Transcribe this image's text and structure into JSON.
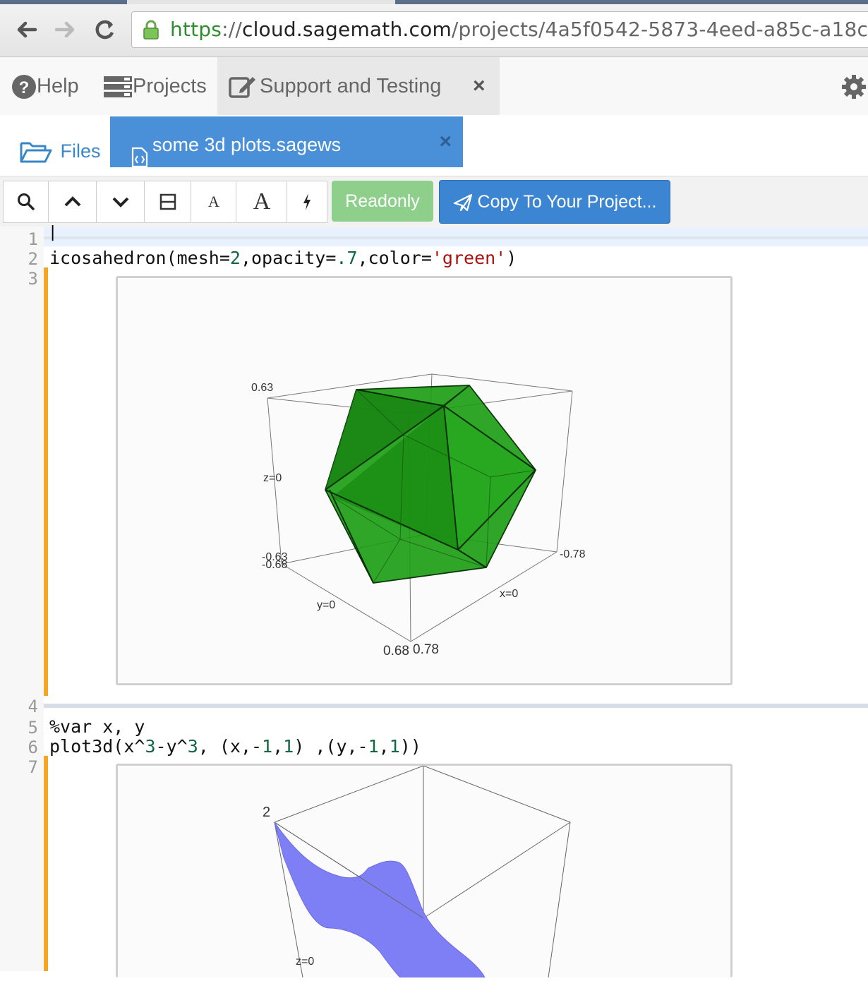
{
  "browser": {
    "url_scheme": "https",
    "url_sep": "://",
    "url_host": "cloud.sagemath.com",
    "url_path": "/projects/4a5f0542-5873-4eed-a85c-a18c",
    "icons": [
      "back-arrow-icon",
      "forward-arrow-icon",
      "reload-icon",
      "lock-icon"
    ]
  },
  "topnav": {
    "help": "Help",
    "projects": "Projects",
    "project_title": "Support and Testing",
    "close": "×"
  },
  "filetabs": {
    "files": "Files",
    "open_file": "some 3d plots.sagews",
    "close": "×"
  },
  "toolbar": {
    "font_small": "A",
    "font_large": "A",
    "readonly": "Readonly",
    "copy": "Copy To Your Project..."
  },
  "editor": {
    "line_numbers": [
      "1",
      "2",
      "3",
      "4",
      "5",
      "6",
      "7"
    ],
    "cursor": "|",
    "cell1": {
      "fn": "icosahedron(mesh=",
      "n1": "2",
      "mid": ",opacity=",
      "n2": ".7",
      "mid2": ",color=",
      "s": "'green'",
      "end": ")"
    },
    "cell2": {
      "line1": "%var x, y",
      "a": "plot3d(x^",
      "n1": "3",
      "b": "-y^",
      "n2": "3",
      "c": ", (x,-",
      "n3": "1",
      "d": ",",
      "n4": "1",
      "e": ") ,(y,-",
      "n5": "1",
      "f": ",",
      "n6": "1",
      "g": "))"
    }
  },
  "plot1": {
    "z_top": "0.63",
    "z_mid": "z=0",
    "z_bot_a": "-0.63",
    "z_bot_b": "-0.68",
    "y_mid": "y=0",
    "x_mid": "x=0",
    "x_right": "-0.78",
    "bottom_a": "0.68",
    "bottom_b": "0.78",
    "fill_color": "#1a9c12",
    "edge_color": "#0c3a0a"
  },
  "plot2": {
    "z_top": "2",
    "z_mid": "z=0",
    "surface_color": "#7f7ff5"
  }
}
